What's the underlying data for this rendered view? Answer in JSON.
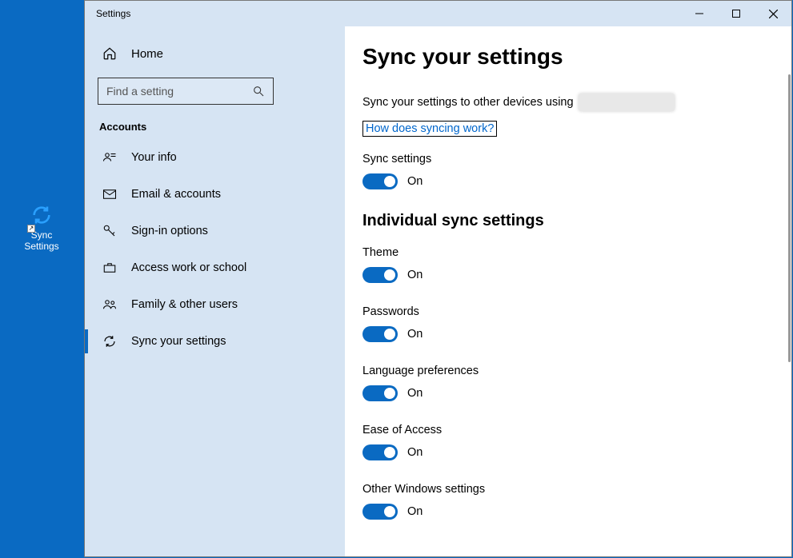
{
  "desktop": {
    "icon_label": "Sync Settings"
  },
  "window": {
    "title": "Settings"
  },
  "sidebar": {
    "home": "Home",
    "search_placeholder": "Find a setting",
    "category": "Accounts",
    "items": [
      {
        "label": "Your info"
      },
      {
        "label": "Email & accounts"
      },
      {
        "label": "Sign-in options"
      },
      {
        "label": "Access work or school"
      },
      {
        "label": "Family & other users"
      },
      {
        "label": "Sync your settings"
      }
    ]
  },
  "content": {
    "heading": "Sync your settings",
    "description": "Sync your settings to other devices using",
    "link": "How does syncing work?",
    "master": {
      "label": "Sync settings",
      "state": "On"
    },
    "sub_heading": "Individual sync settings",
    "toggles": [
      {
        "label": "Theme",
        "state": "On"
      },
      {
        "label": "Passwords",
        "state": "On"
      },
      {
        "label": "Language preferences",
        "state": "On"
      },
      {
        "label": "Ease of Access",
        "state": "On"
      },
      {
        "label": "Other Windows settings",
        "state": "On"
      }
    ]
  }
}
